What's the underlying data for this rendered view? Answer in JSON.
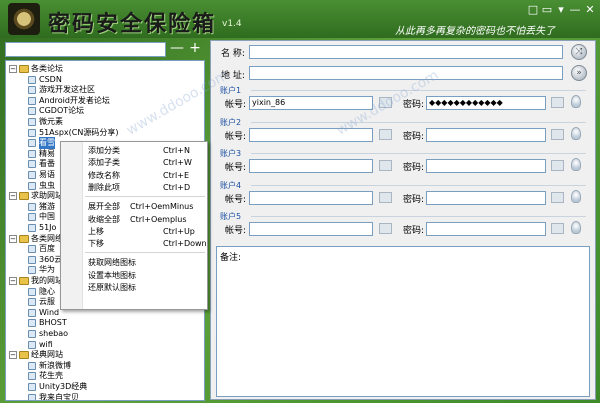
{
  "app": {
    "title": "密码安全保险箱",
    "version": "v1.4",
    "slogan": "从此再多再复杂的密码也不怕丢失了"
  },
  "window_controls": [
    "□",
    "▭",
    "▾",
    "—",
    "✕"
  ],
  "tree_panel": {
    "search_value": "",
    "add_button": "+",
    "collapse_button": "—",
    "items": [
      {
        "label": "各类论坛",
        "level": 0,
        "folder": true
      },
      {
        "label": "CSDN",
        "level": 1
      },
      {
        "label": "游戏开发这社区",
        "level": 1
      },
      {
        "label": "Android开发者论坛",
        "level": 1
      },
      {
        "label": "CGDOT论坛",
        "level": 1
      },
      {
        "label": "微元素",
        "level": 1
      },
      {
        "label": "51Aspx(CN源码分享)",
        "level": 1
      },
      {
        "label": "看雪",
        "level": 1,
        "selected": true
      },
      {
        "label": "精易",
        "level": 1
      },
      {
        "label": "看番",
        "level": 1
      },
      {
        "label": "易语",
        "level": 1
      },
      {
        "label": "虫虫",
        "level": 1
      },
      {
        "label": "求助网站",
        "level": 0,
        "folder": true
      },
      {
        "label": "猪游",
        "level": 1
      },
      {
        "label": "中国",
        "level": 1
      },
      {
        "label": "51Jo",
        "level": 1
      },
      {
        "label": "各类网络",
        "level": 0,
        "folder": true
      },
      {
        "label": "百度",
        "level": 1
      },
      {
        "label": "360云",
        "level": 1
      },
      {
        "label": "华为",
        "level": 1
      },
      {
        "label": "我的网站",
        "level": 0,
        "folder": true
      },
      {
        "label": "隐心",
        "level": 1
      },
      {
        "label": "云服",
        "level": 1
      },
      {
        "label": "Wind",
        "level": 1
      },
      {
        "label": "BHOST",
        "level": 1
      },
      {
        "label": "shebao",
        "level": 1
      },
      {
        "label": "wifi",
        "level": 1
      },
      {
        "label": "经典网站",
        "level": 0,
        "folder": true
      },
      {
        "label": "新浪微博",
        "level": 1
      },
      {
        "label": "花生壳",
        "level": 1
      },
      {
        "label": "Unity3D经典",
        "level": 1
      },
      {
        "label": "我来自宝贝",
        "level": 1
      }
    ]
  },
  "context_menu": {
    "items": [
      {
        "label": "添加分类",
        "shortcut": "Ctrl+N"
      },
      {
        "label": "添加子类",
        "shortcut": "Ctrl+W"
      },
      {
        "label": "修改名称",
        "shortcut": "Ctrl+E"
      },
      {
        "label": "删除此项",
        "shortcut": "Ctrl+D"
      },
      {
        "separator": true
      },
      {
        "label": "展开全部",
        "shortcut": "Ctrl+OemMinus"
      },
      {
        "label": "收缩全部",
        "shortcut": "Ctrl+Oemplus"
      },
      {
        "label": "上移",
        "shortcut": "Ctrl+Up"
      },
      {
        "label": "下移",
        "shortcut": "Ctrl+Down"
      },
      {
        "separator": true
      },
      {
        "label": "获取网络图标",
        "shortcut": ""
      },
      {
        "label": "设置本地图标",
        "shortcut": ""
      },
      {
        "label": "还原默认图标",
        "shortcut": ""
      }
    ]
  },
  "detail": {
    "name_label": "名 称:",
    "name_value": "",
    "address_label": "地 址:",
    "address_value": "",
    "account_label": "帐号:",
    "password_label": "密码:",
    "accounts": [
      {
        "title": "账户1",
        "account": "yixin_86",
        "password": "◆◆◆◆◆◆◆◆◆◆◆◆"
      },
      {
        "title": "账户2",
        "account": "",
        "password": ""
      },
      {
        "title": "账户3",
        "account": "",
        "password": ""
      },
      {
        "title": "账户4",
        "account": "",
        "password": ""
      },
      {
        "title": "账户5",
        "account": "",
        "password": ""
      }
    ],
    "memo_label": "备注:",
    "memo_value": ""
  },
  "colors": {
    "accent": "#3477c6",
    "group_title": "#1b4fa0",
    "title_bar": "#2f6c1f"
  }
}
